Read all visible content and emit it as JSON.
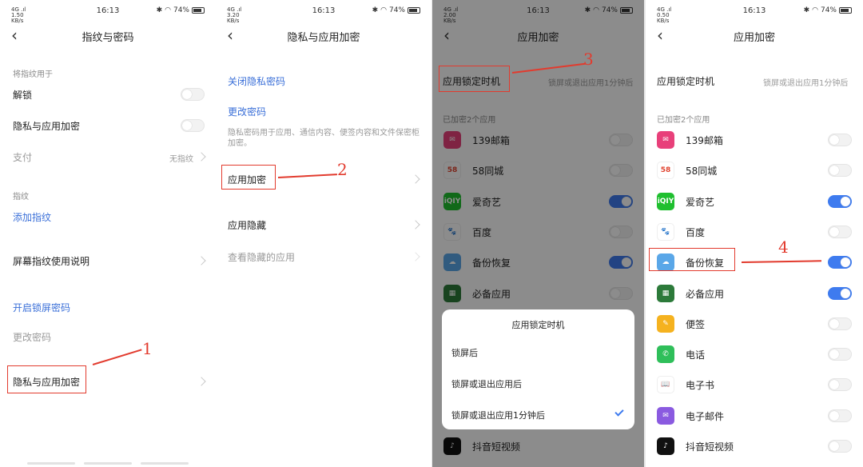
{
  "status": {
    "p1": {
      "signal": "4G .ıl 1.50 KB/s",
      "time": "16:13",
      "battery": "74%"
    },
    "p2": {
      "signal": "4G .ıl 3.20 KB/s",
      "time": "16:13",
      "battery": "74%"
    },
    "p3": {
      "signal": "4G .ıl 2.00 KB/s",
      "time": "16:13",
      "battery": "74%"
    },
    "p4": {
      "signal": "4G .ıl 0.50 KB/s",
      "time": "16:13",
      "battery": "74%"
    }
  },
  "panel1": {
    "title": "指纹与密码",
    "section_use": "将指纹用于",
    "unlock": "解锁",
    "privacy_encrypt": "隐私与应用加密",
    "pay": "支付",
    "pay_hint": "无指纹",
    "section_fp": "指纹",
    "add_fp": "添加指纹",
    "fp_guide": "屏幕指纹使用说明",
    "lock_pwd": "开启锁屏密码",
    "change_pwd": "更改密码",
    "privacy_app": "隐私与应用加密",
    "annotation": "1",
    "toggles": {
      "unlock": false,
      "privacy": false
    }
  },
  "panel2": {
    "title": "隐私与应用加密",
    "close_pwd": "关闭隐私密码",
    "change_pwd": "更改密码",
    "desc": "隐私密码用于应用、通信内容、便签内容和文件保密柜加密。",
    "app_encrypt": "应用加密",
    "app_hide": "应用隐藏",
    "view_hidden": "查看隐藏的应用",
    "annotation": "2"
  },
  "panel3": {
    "title": "应用加密",
    "lock_timing": "应用锁定时机",
    "lock_timing_value": "锁屏或退出应用1分钟后",
    "encrypted_count": "已加密2个应用",
    "annotation": "3",
    "apps": [
      {
        "name": "139邮箱",
        "on": false
      },
      {
        "name": "58同城",
        "on": false
      },
      {
        "name": "爱奇艺",
        "on": true
      },
      {
        "name": "百度",
        "on": false
      },
      {
        "name": "备份恢复",
        "on": true
      },
      {
        "name": "必备应用",
        "on": false
      }
    ],
    "last_app": "抖音短视频",
    "sheet": {
      "title": "应用锁定时机",
      "options": [
        "锁屏后",
        "锁屏或退出应用后",
        "锁屏或退出应用1分钟后"
      ],
      "selected_index": 2
    }
  },
  "panel4": {
    "title": "应用加密",
    "lock_timing": "应用锁定时机",
    "lock_timing_value": "锁屏或退出应用1分钟后",
    "encrypted_count": "已加密2个应用",
    "annotation": "4",
    "apps": [
      {
        "name": "139邮箱",
        "on": false
      },
      {
        "name": "58同城",
        "on": false
      },
      {
        "name": "爱奇艺",
        "on": true
      },
      {
        "name": "百度",
        "on": false
      },
      {
        "name": "备份恢复",
        "on": true
      },
      {
        "name": "必备应用",
        "on": true
      },
      {
        "name": "便签",
        "on": false
      },
      {
        "name": "电话",
        "on": false
      },
      {
        "name": "电子书",
        "on": false
      },
      {
        "name": "电子邮件",
        "on": false
      },
      {
        "name": "抖音短视频",
        "on": false
      }
    ]
  },
  "icons": {
    "139邮箱": {
      "label": "✉",
      "color": "#e8407a"
    },
    "58同城": {
      "label": "58",
      "color": "#ffffff"
    },
    "爱奇艺": {
      "label": "iQIY",
      "color": "#1fbf2f"
    },
    "百度": {
      "label": "🐾",
      "color": "#ffffff"
    },
    "备份恢复": {
      "label": "☁",
      "color": "#5aa7e8"
    },
    "必备应用": {
      "label": "▦",
      "color": "#2c7a3a"
    },
    "便签": {
      "label": "✎",
      "color": "#f5b21f"
    },
    "电话": {
      "label": "✆",
      "color": "#2fbf5a"
    },
    "电子书": {
      "label": "📖",
      "color": "#ffffff"
    },
    "电子邮件": {
      "label": "✉",
      "color": "#8a5ae0"
    },
    "抖音短视频": {
      "label": "♪",
      "color": "#111111"
    }
  },
  "colors": {
    "accent": "#3e7bef",
    "annotation": "#e23b2e",
    "link": "#3a6fd8"
  }
}
